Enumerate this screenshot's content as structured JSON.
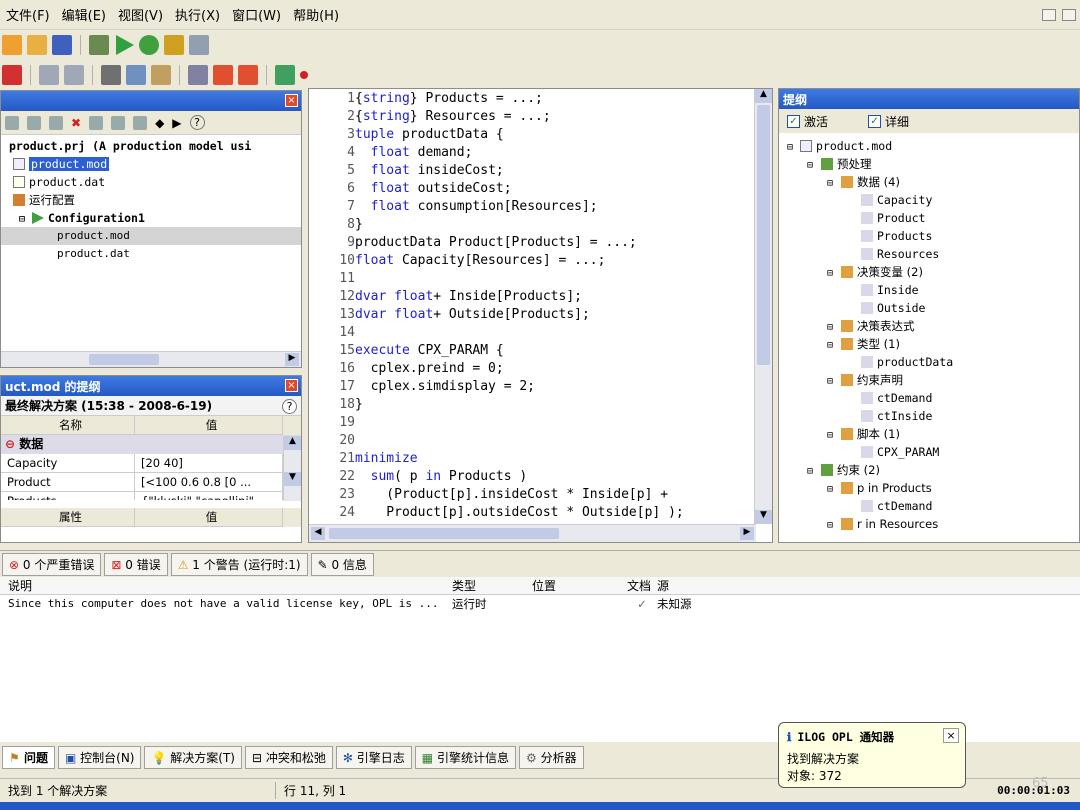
{
  "menu": [
    "文件(F)",
    "编辑(E)",
    "视图(V)",
    "执行(X)",
    "窗口(W)",
    "帮助(H)"
  ],
  "projects": {
    "title": "",
    "project": "product.prj (A production model usi",
    "files": [
      "product.mod",
      "product.dat"
    ],
    "run_configs": "运行配置",
    "config": "Configuration1",
    "config_files": [
      "product.mod",
      "product.dat"
    ]
  },
  "solution": {
    "title": "uct.mod 的提纲",
    "header": "最终解决方案 (15:38 - 2008-6-19)",
    "col_name": "名称",
    "col_value": "值",
    "group": "数据",
    "rows": [
      {
        "name": "Capacity",
        "value": "[20 40]"
      },
      {
        "name": "Product",
        "value": "[<100 0.6 0.8 [0 ..."
      },
      {
        "name": "Products",
        "value": "{\"kluski\" \"capellini\"..."
      }
    ]
  },
  "properties": {
    "col_attr": "属性",
    "col_value": "值"
  },
  "editor": {
    "lines": [
      {
        "n": "1",
        "t": "{string} Products = ...;"
      },
      {
        "n": "2",
        "t": "{string} Resources = ...;"
      },
      {
        "n": "3",
        "t": "tuple productData {"
      },
      {
        "n": "4",
        "t": "  float demand;"
      },
      {
        "n": "5",
        "t": "  float insideCost;"
      },
      {
        "n": "6",
        "t": "  float outsideCost;"
      },
      {
        "n": "7",
        "t": "  float consumption[Resources];"
      },
      {
        "n": "8",
        "t": "}"
      },
      {
        "n": "9",
        "t": "productData Product[Products] = ...;"
      },
      {
        "n": "10",
        "t": "float Capacity[Resources] = ...;"
      },
      {
        "n": "11",
        "t": ""
      },
      {
        "n": "12",
        "t": "dvar float+ Inside[Products];"
      },
      {
        "n": "13",
        "t": "dvar float+ Outside[Products];"
      },
      {
        "n": "14",
        "t": ""
      },
      {
        "n": "15",
        "t": "execute CPX_PARAM {"
      },
      {
        "n": "16",
        "t": "  cplex.preind = 0;"
      },
      {
        "n": "17",
        "t": "  cplex.simdisplay = 2;"
      },
      {
        "n": "18",
        "t": "}"
      },
      {
        "n": "19",
        "t": ""
      },
      {
        "n": "20",
        "t": ""
      },
      {
        "n": "21",
        "t": "minimize"
      },
      {
        "n": "22",
        "t": "  sum( p in Products )"
      },
      {
        "n": "23",
        "t": "    (Product[p].insideCost * Inside[p] +"
      },
      {
        "n": "24",
        "t": "    Product[p].outsideCost * Outside[p] );"
      }
    ]
  },
  "outline": {
    "title": "提纲",
    "check_active": "激活",
    "check_detail": "详细",
    "root": "product.mod",
    "items": [
      {
        "indent": 1,
        "label": "预处理"
      },
      {
        "indent": 2,
        "label": "数据 (4)"
      },
      {
        "indent": 3,
        "label": "Capacity"
      },
      {
        "indent": 3,
        "label": "Product"
      },
      {
        "indent": 3,
        "label": "Products"
      },
      {
        "indent": 3,
        "label": "Resources"
      },
      {
        "indent": 2,
        "label": "决策变量 (2)"
      },
      {
        "indent": 3,
        "label": "Inside"
      },
      {
        "indent": 3,
        "label": "Outside"
      },
      {
        "indent": 2,
        "label": "决策表达式"
      },
      {
        "indent": 2,
        "label": "类型 (1)"
      },
      {
        "indent": 3,
        "label": "productData"
      },
      {
        "indent": 2,
        "label": "约束声明"
      },
      {
        "indent": 3,
        "label": "ctDemand"
      },
      {
        "indent": 3,
        "label": "ctInside"
      },
      {
        "indent": 2,
        "label": "脚本 (1)"
      },
      {
        "indent": 3,
        "label": "CPX_PARAM"
      },
      {
        "indent": 1,
        "label": "约束 (2)"
      },
      {
        "indent": 2,
        "label": "p in Products"
      },
      {
        "indent": 3,
        "label": "ctDemand"
      },
      {
        "indent": 2,
        "label": "r in Resources"
      }
    ]
  },
  "problems": {
    "tabs": [
      "0 个严重错误",
      "0 错误",
      "1 个警告 (运行时:1)",
      "0 信息"
    ],
    "cols": [
      "说明",
      "类型",
      "位置",
      "文档",
      "源"
    ],
    "row": {
      "desc": "Since this computer does not have a valid license key, OPL is ...",
      "type": "运行时",
      "loc": "",
      "doc": "✓",
      "src": "未知源"
    }
  },
  "bottom_tabs": [
    "问题",
    "控制台(N)",
    "解决方案(T)",
    "冲突和松弛",
    "引擎日志",
    "引擎统计信息",
    "分析器"
  ],
  "notifier": {
    "title": "ILOG OPL 通知器",
    "line1": "找到解决方案",
    "line2": "对象: 372"
  },
  "status": {
    "left": "找到 1 个解决方案",
    "pos": "行 11, 列 1",
    "time": "00:00:01:03",
    "page": "65"
  },
  "colors": {
    "title_blue": "#2458c6",
    "keyword": "#2020d0"
  }
}
